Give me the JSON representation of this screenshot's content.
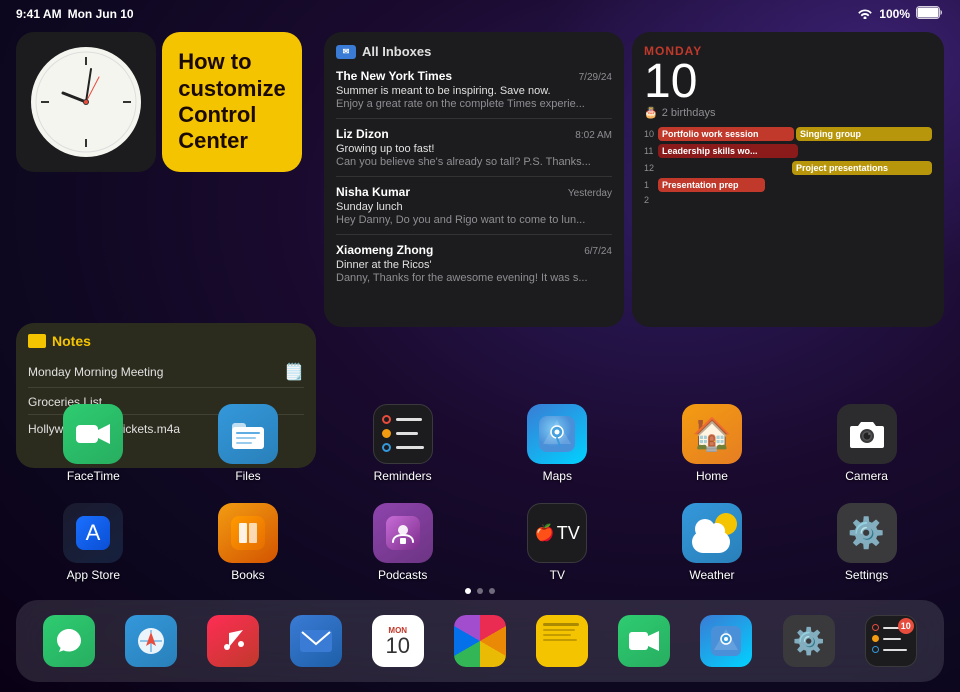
{
  "status_bar": {
    "time": "9:41 AM",
    "date": "Mon Jun 10",
    "wifi_label": "WiFi",
    "battery": "100%"
  },
  "clock_widget": {
    "label": "Clock"
  },
  "howto_widget": {
    "line1": "How to",
    "line2": "customize",
    "line3": "Control",
    "line4": "Center"
  },
  "notes_widget": {
    "title": "Notes",
    "items": [
      "Monday Morning Meeting",
      "Groceries List",
      "Hollywood Hills crickets.m4a"
    ]
  },
  "mail_widget": {
    "header": "All Inboxes",
    "emails": [
      {
        "sender": "The New York Times",
        "date": "7/29/24",
        "subject": "Summer is meant to be inspiring. Save now.",
        "preview": "Enjoy a great rate on the complete Times experie..."
      },
      {
        "sender": "Liz Dizon",
        "date": "8:02 AM",
        "subject": "Growing up too fast!",
        "preview": "Can you believe she's already so tall? P.S. Thanks..."
      },
      {
        "sender": "Nisha Kumar",
        "date": "Yesterday",
        "subject": "Sunday lunch",
        "preview": "Hey Danny, Do you and Rigo want to come to lun..."
      },
      {
        "sender": "Xiaomeng Zhong",
        "date": "6/7/24",
        "subject": "Dinner at the Ricos'",
        "preview": "Danny, Thanks for the awesome evening! It was s..."
      }
    ]
  },
  "calendar_widget": {
    "day_name": "MONDAY",
    "date": "10",
    "birthdays": "2 birthdays",
    "events": [
      {
        "time": "10",
        "col": 1,
        "text": "Portfolio work session",
        "type": "red"
      },
      {
        "time": "10",
        "col": 2,
        "text": "Singing group",
        "type": "yellow"
      },
      {
        "time": "11",
        "col": 1,
        "text": "Leadership skills wo...",
        "type": "dark-red"
      },
      {
        "time": "12",
        "col": 2,
        "text": "Project presentations",
        "type": "yellow"
      },
      {
        "time": "1",
        "col": 1,
        "text": "Presentation prep",
        "type": "red"
      }
    ]
  },
  "app_row1": [
    {
      "id": "facetime",
      "label": "FaceTime",
      "icon": "📹"
    },
    {
      "id": "files",
      "label": "Files",
      "icon": "🗂️"
    },
    {
      "id": "reminders",
      "label": "Reminders",
      "icon": ""
    },
    {
      "id": "maps",
      "label": "Maps",
      "icon": ""
    },
    {
      "id": "home",
      "label": "Home",
      "icon": "🏠"
    },
    {
      "id": "camera",
      "label": "Camera",
      "icon": "📷"
    }
  ],
  "app_row2": [
    {
      "id": "appstore",
      "label": "App Store",
      "icon": ""
    },
    {
      "id": "books",
      "label": "Books",
      "icon": ""
    },
    {
      "id": "podcasts",
      "label": "Podcasts",
      "icon": ""
    },
    {
      "id": "tv",
      "label": "TV",
      "icon": ""
    },
    {
      "id": "weather",
      "label": "Weather",
      "icon": ""
    },
    {
      "id": "settings",
      "label": "Settings",
      "icon": "⚙️"
    }
  ],
  "dock": {
    "items": [
      {
        "id": "messages",
        "label": "Messages"
      },
      {
        "id": "safari",
        "label": "Safari"
      },
      {
        "id": "music",
        "label": "Music"
      },
      {
        "id": "mail",
        "label": "Mail"
      },
      {
        "id": "calendar",
        "label": "Calendar",
        "day": "MON",
        "date": "10"
      },
      {
        "id": "photos",
        "label": "Photos"
      },
      {
        "id": "notes",
        "label": "Notes"
      },
      {
        "id": "facetime",
        "label": "FaceTime"
      },
      {
        "id": "maps",
        "label": "Maps"
      },
      {
        "id": "settings",
        "label": "Settings"
      },
      {
        "id": "reminder2",
        "label": "Reminders"
      }
    ]
  },
  "page_dots": 3,
  "active_dot": 0
}
